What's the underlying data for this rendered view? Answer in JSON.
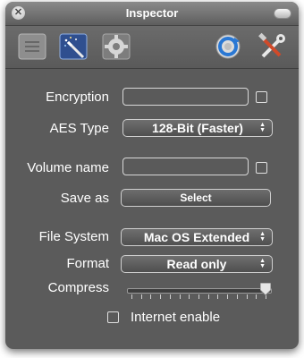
{
  "window": {
    "title": "Inspector"
  },
  "toolbar": {
    "icons": [
      "list-icon",
      "magic-wand-icon",
      "gear-icon",
      "refresh-icon",
      "tools-icon"
    ]
  },
  "form": {
    "encryption": {
      "label": "Encryption",
      "value": "",
      "checked": false
    },
    "aes_type": {
      "label": "AES Type",
      "value": "128-Bit (Faster)"
    },
    "volume_name": {
      "label": "Volume name",
      "value": "",
      "checked": false
    },
    "save_as": {
      "label": "Save as",
      "button": "Select"
    },
    "file_system": {
      "label": "File System",
      "value": "Mac OS Extended"
    },
    "format": {
      "label": "Format",
      "value": "Read only"
    },
    "compress": {
      "label": "Compress",
      "level": 1.0,
      "ticks": 15
    },
    "internet_enable": {
      "label": "Internet enable",
      "checked": false
    }
  },
  "colors": {
    "window_bg": "#5b5b5b",
    "text": "#ffffff"
  }
}
